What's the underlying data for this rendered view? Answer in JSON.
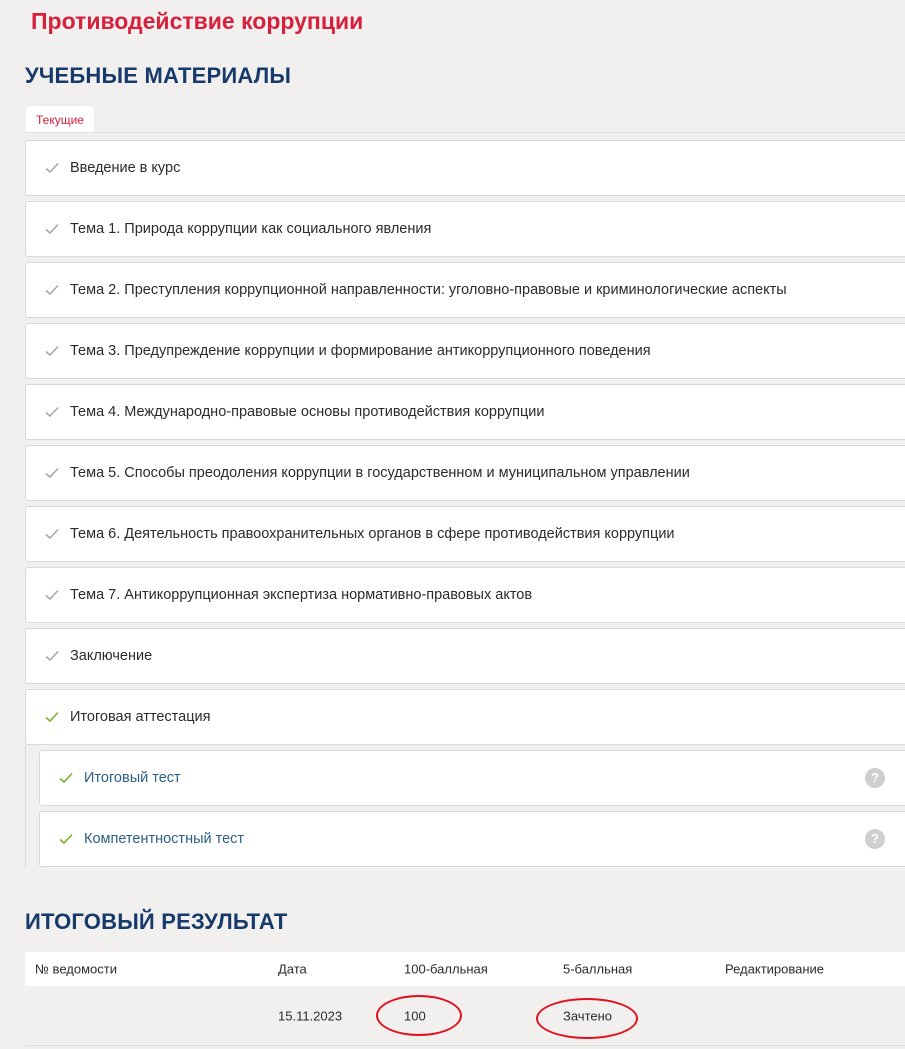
{
  "course": {
    "title": "Противодействие коррупции"
  },
  "materials": {
    "heading": "УЧЕБНЫЕ МАТЕРИАЛЫ",
    "tab_label": "Текущие",
    "items": [
      {
        "label": "Введение в курс",
        "status": "done"
      },
      {
        "label": "Тема 1. Природа коррупции как социального явления",
        "status": "done"
      },
      {
        "label": "Тема 2. Преступления коррупционной направленности: уголовно-правовые и криминологические аспекты",
        "status": "done"
      },
      {
        "label": "Тема 3. Предупреждение коррупции и формирование антикоррупционного поведения",
        "status": "done"
      },
      {
        "label": "Тема 4. Международно-правовые основы противодействия коррупции",
        "status": "done"
      },
      {
        "label": "Тема 5. Способы преодоления коррупции в государственном и муниципальном управлении",
        "status": "done"
      },
      {
        "label": "Тема 6. Деятельность правоохранительных органов в сфере противодействия коррупции",
        "status": "done"
      },
      {
        "label": "Тема 7. Антикоррупционная экспертиза нормативно-правовых актов",
        "status": "done"
      },
      {
        "label": "Заключение",
        "status": "done"
      },
      {
        "label": "Итоговая аттестация",
        "status": "passed"
      }
    ],
    "subitems": [
      {
        "label": "Итоговый тест",
        "help": "?"
      },
      {
        "label": "Компетентностный тест",
        "help": "?"
      }
    ]
  },
  "result": {
    "heading": "ИТОГОВЫЙ РЕЗУЛЬТАТ",
    "columns": [
      "№ ведомости",
      "Дата",
      "100-балльная",
      "5-балльная",
      "Редактирование"
    ],
    "rows": [
      {
        "number": "",
        "date": "15.11.2023",
        "score100": "100",
        "score5": "Зачтено",
        "edit": ""
      }
    ]
  },
  "colors": {
    "accent_red": "#d7203d",
    "heading_blue": "#163a6b",
    "check_grey": "#a8a8a8",
    "check_green": "#7bb02e",
    "annotation_red": "#e0101e"
  }
}
